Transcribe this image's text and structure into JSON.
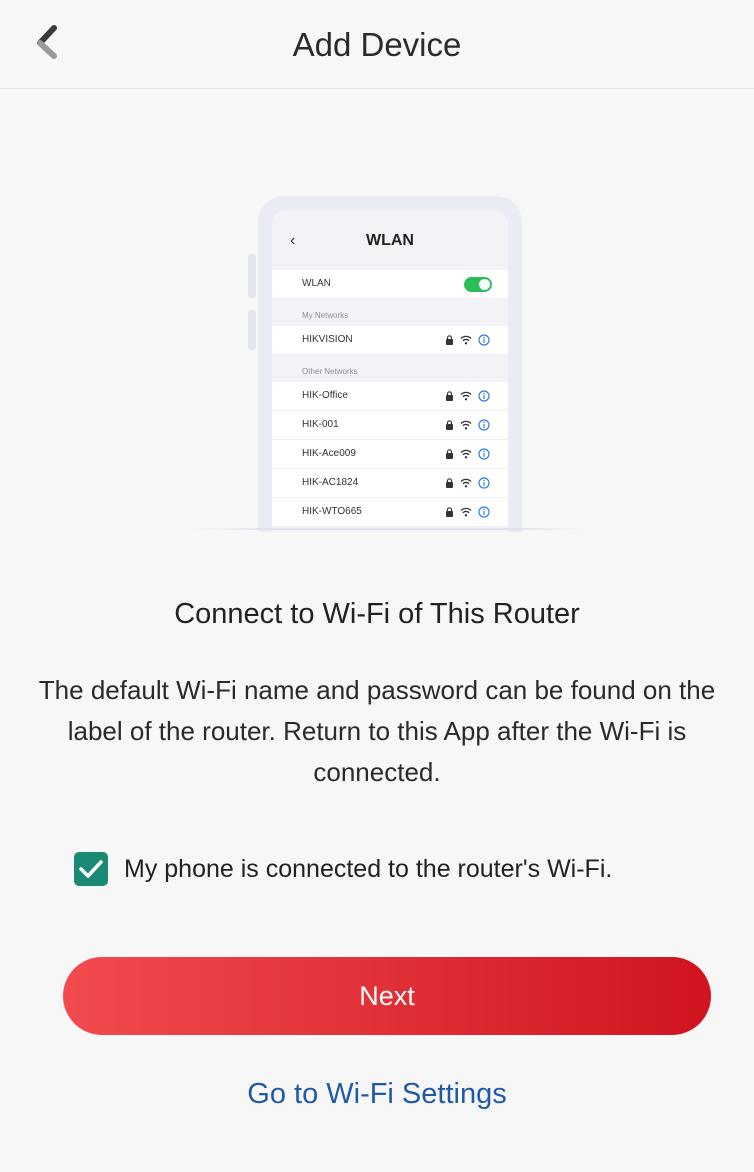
{
  "header": {
    "title": "Add Device",
    "back_icon": "back-arrow-icon"
  },
  "illustration": {
    "title": "WLAN",
    "wlan_label": "WLAN",
    "wlan_on": true,
    "my_networks_heading": "My Networks",
    "my_networks": [
      "HIKVISION"
    ],
    "other_networks_heading": "Other Networks",
    "other_networks": [
      "HIK-Office",
      "HIK-001",
      "HIK-Ace009",
      "HIK-AC1824",
      "HIK-WTO665"
    ]
  },
  "main": {
    "title": "Connect to Wi-Fi of This Router",
    "description": "The default Wi-Fi name and password can be found on the label of the router. Return to this App after the Wi-Fi is connected.",
    "checkbox_label": "My phone is connected to the router's Wi-Fi.",
    "checkbox_checked": true,
    "next_label": "Next",
    "wifi_settings_label": "Go to Wi-Fi Settings"
  },
  "colors": {
    "accent_red_start": "#f24b4f",
    "accent_red_end": "#d01420",
    "checkbox_teal": "#1a8a75",
    "link_blue": "#1e5aa8",
    "toggle_green": "#2bbd5a"
  }
}
